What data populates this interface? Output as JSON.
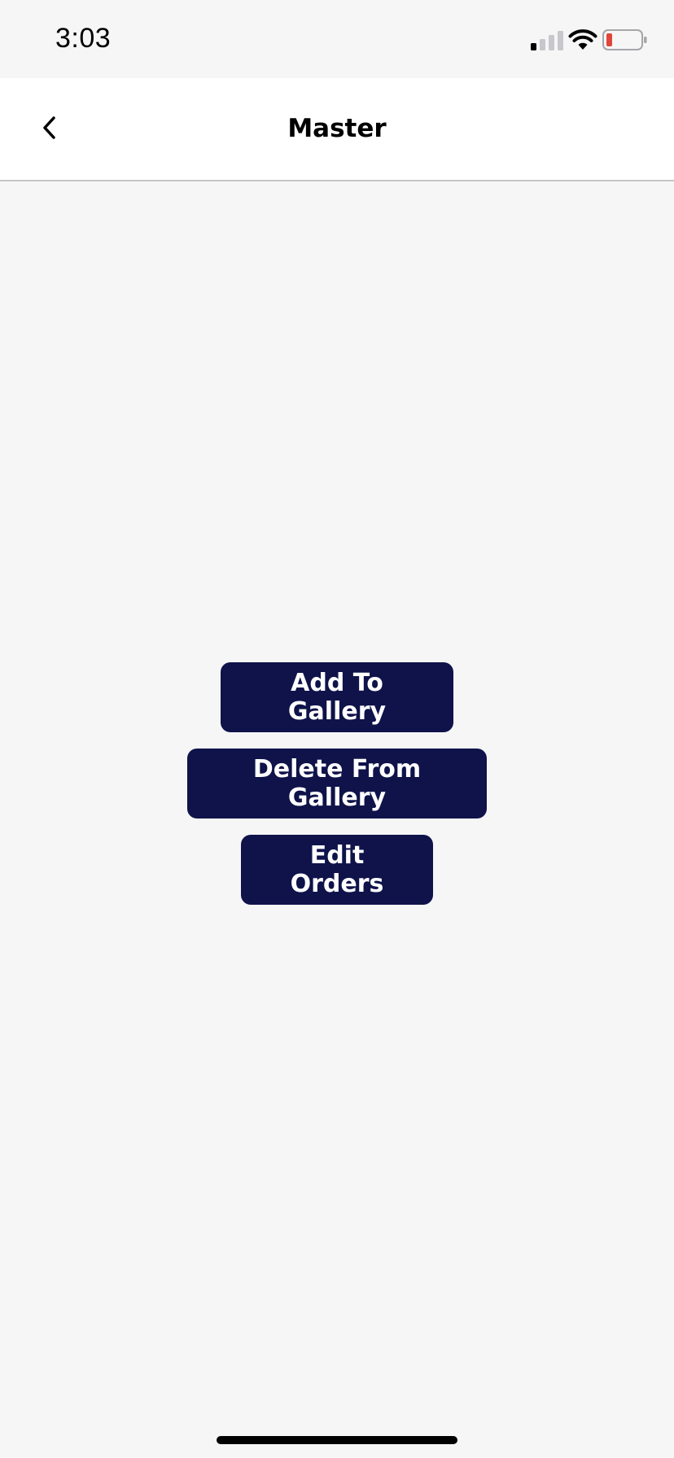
{
  "status_bar": {
    "time": "3:03",
    "icons": [
      "signal-icon",
      "wifi-icon",
      "battery-icon"
    ],
    "battery_level": "low",
    "battery_color": "#e0463c"
  },
  "nav": {
    "title": "Master",
    "back_icon": "chevron-left-icon"
  },
  "actions": {
    "add_to_gallery": "Add To Gallery",
    "delete_from_gallery": "Delete From Gallery",
    "edit_orders": "Edit Orders"
  },
  "colors": {
    "button_bg": "#0f134a",
    "button_text": "#ffffff",
    "background": "#f6f6f7"
  }
}
